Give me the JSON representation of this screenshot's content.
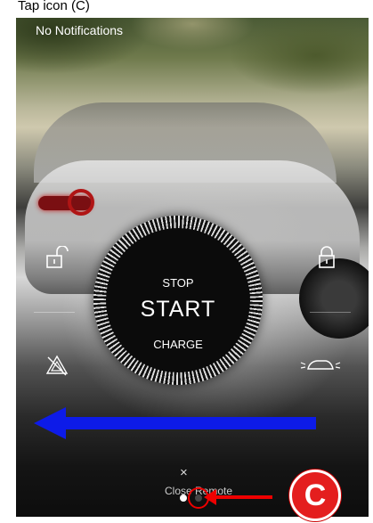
{
  "caption": "Tap icon (C)",
  "notifications": {
    "label": "No Notifications"
  },
  "dial": {
    "stop_label": "STOP",
    "start_label": "START",
    "charge_label": "CHARGE"
  },
  "icons": {
    "unlock": "unlock-icon",
    "lock": "lock-icon",
    "hazard": "hazard-icon",
    "lights": "car-lights-icon",
    "close": "close-icon"
  },
  "close": {
    "symbol": "×",
    "label": "Close Remote"
  },
  "pager": {
    "page_count": 2,
    "active_index": 0
  },
  "annotation": {
    "callout_letter": "C",
    "arrow_color": "#0d1be8",
    "callout_color": "#e41e1e"
  }
}
